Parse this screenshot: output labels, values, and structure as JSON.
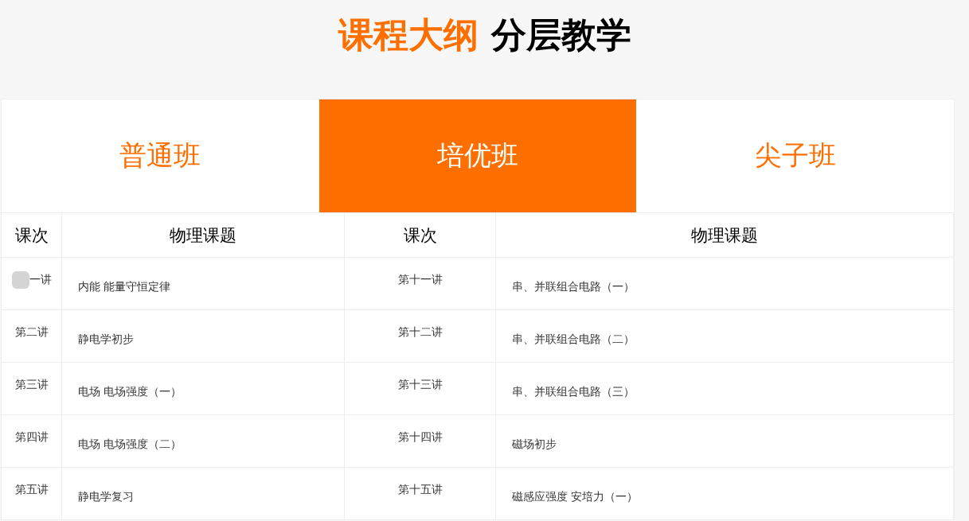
{
  "title": [
    {
      "text": "课程大纲",
      "kind": "accent"
    },
    {
      "text": "分层教学",
      "kind": "plain"
    }
  ],
  "tabs": [
    {
      "label": "普通班",
      "selected": false
    },
    {
      "label": "培优班",
      "selected": true
    },
    {
      "label": "尖子班",
      "selected": false
    }
  ],
  "table": {
    "columns": [
      "课次",
      "物理课题",
      "课次",
      "物理课题"
    ],
    "rows": [
      {
        "cells": [
          "一讲",
          "内能 能量守恒定律",
          "第十一讲",
          "串、并联组合电路（一）"
        ],
        "obscured": true
      },
      {
        "cells": [
          "第二讲",
          "静电学初步",
          "第十二讲",
          "串、并联组合电路（二）"
        ],
        "obscured": false
      },
      {
        "cells": [
          "第三讲",
          "电场 电场强度（一）",
          "第十三讲",
          "串、并联组合电路（三）"
        ],
        "obscured": false
      },
      {
        "cells": [
          "第四讲",
          "电场 电场强度（二）",
          "第十四讲",
          "磁场初步"
        ],
        "obscured": false
      },
      {
        "cells": [
          "第五讲",
          "静电学复习",
          "第十五讲",
          "磁感应强度 安培力（一）"
        ],
        "obscured": false
      }
    ]
  }
}
